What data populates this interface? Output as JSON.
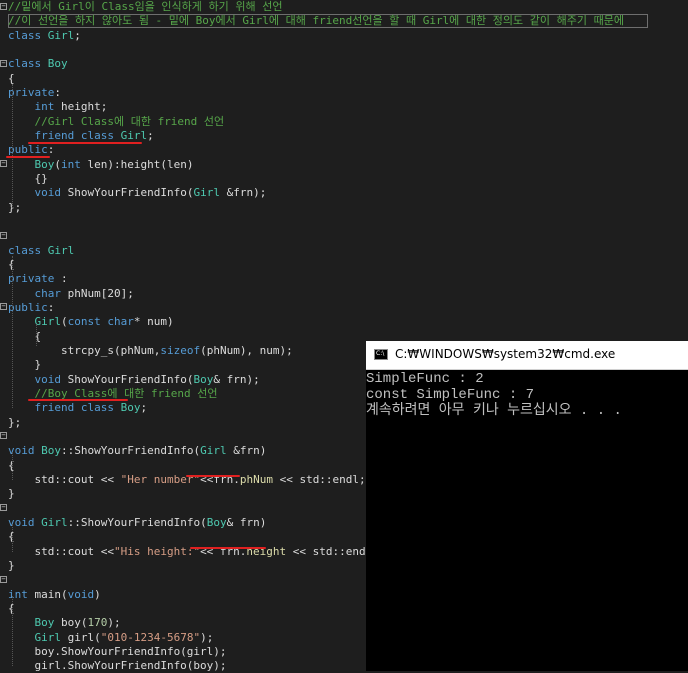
{
  "editor": {
    "lines": [
      {
        "segments": [
          {
            "t": "//밑에서 Girl이 Class임을 인식하게 하기 위해 선언",
            "c": "cm"
          }
        ]
      },
      {
        "segments": [
          {
            "t": "//이 선언을 하지 않아도 됨 - 밑에 Boy에서 Girl에 대해 friend선언을 할 때 Girl에 대한 정의도 같이 해주기 때문에",
            "c": "cm"
          }
        ]
      },
      {
        "segments": [
          {
            "t": "class ",
            "c": "kw"
          },
          {
            "t": "Girl",
            "c": "cls"
          },
          {
            "t": ";",
            "c": "tx"
          }
        ]
      },
      {
        "segments": []
      },
      {
        "segments": [
          {
            "t": "class ",
            "c": "kw"
          },
          {
            "t": "Boy",
            "c": "cls"
          }
        ]
      },
      {
        "segments": [
          {
            "t": "{",
            "c": "tx"
          }
        ]
      },
      {
        "segments": [
          {
            "t": "private",
            "c": "kw"
          },
          {
            "t": ":",
            "c": "tx"
          }
        ]
      },
      {
        "segments": [
          {
            "t": "    ",
            "c": "tx"
          },
          {
            "t": "int ",
            "c": "kw"
          },
          {
            "t": "height;",
            "c": "tx"
          }
        ]
      },
      {
        "segments": [
          {
            "t": "    //Girl Class에 대한 friend 선언",
            "c": "cm"
          }
        ]
      },
      {
        "segments": [
          {
            "t": "    ",
            "c": "tx"
          },
          {
            "t": "friend class ",
            "c": "kw"
          },
          {
            "t": "Girl",
            "c": "cls"
          },
          {
            "t": ";",
            "c": "tx"
          }
        ]
      },
      {
        "segments": [
          {
            "t": "public",
            "c": "kw"
          },
          {
            "t": ":",
            "c": "tx"
          }
        ]
      },
      {
        "segments": [
          {
            "t": "    ",
            "c": "tx"
          },
          {
            "t": "Boy",
            "c": "cls"
          },
          {
            "t": "(",
            "c": "tx"
          },
          {
            "t": "int ",
            "c": "kw"
          },
          {
            "t": "len):height(len)",
            "c": "tx"
          }
        ]
      },
      {
        "segments": [
          {
            "t": "    {}",
            "c": "tx"
          }
        ]
      },
      {
        "segments": [
          {
            "t": "    ",
            "c": "tx"
          },
          {
            "t": "void ",
            "c": "kw"
          },
          {
            "t": "ShowYourFriendInfo(",
            "c": "tx"
          },
          {
            "t": "Girl",
            "c": "cls"
          },
          {
            "t": " &frn);",
            "c": "tx"
          }
        ]
      },
      {
        "segments": [
          {
            "t": "};",
            "c": "tx"
          }
        ]
      },
      {
        "segments": []
      },
      {
        "segments": []
      },
      {
        "segments": [
          {
            "t": "class ",
            "c": "kw"
          },
          {
            "t": "Girl",
            "c": "cls"
          }
        ]
      },
      {
        "segments": [
          {
            "t": "{",
            "c": "tx"
          }
        ]
      },
      {
        "segments": [
          {
            "t": "private ",
            "c": "kw"
          },
          {
            "t": ":",
            "c": "tx"
          }
        ]
      },
      {
        "segments": [
          {
            "t": "    ",
            "c": "tx"
          },
          {
            "t": "char ",
            "c": "kw"
          },
          {
            "t": "phNum[20];",
            "c": "tx"
          }
        ]
      },
      {
        "segments": [
          {
            "t": "public",
            "c": "kw"
          },
          {
            "t": ":",
            "c": "tx"
          }
        ]
      },
      {
        "segments": [
          {
            "t": "    ",
            "c": "tx"
          },
          {
            "t": "Girl",
            "c": "cls"
          },
          {
            "t": "(",
            "c": "tx"
          },
          {
            "t": "const char",
            "c": "kw"
          },
          {
            "t": "* num)",
            "c": "tx"
          }
        ]
      },
      {
        "segments": [
          {
            "t": "    {",
            "c": "tx"
          }
        ]
      },
      {
        "segments": [
          {
            "t": "        strcpy_s(phNum,",
            "c": "tx"
          },
          {
            "t": "sizeof",
            "c": "kw"
          },
          {
            "t": "(phNum), num);",
            "c": "tx"
          }
        ]
      },
      {
        "segments": [
          {
            "t": "    }",
            "c": "tx"
          }
        ]
      },
      {
        "segments": [
          {
            "t": "    ",
            "c": "tx"
          },
          {
            "t": "void ",
            "c": "kw"
          },
          {
            "t": "ShowYourFriendInfo(",
            "c": "tx"
          },
          {
            "t": "Boy",
            "c": "cls"
          },
          {
            "t": "& frn);",
            "c": "tx"
          }
        ]
      },
      {
        "segments": [
          {
            "t": "    //Boy Class에 대한 friend 선언",
            "c": "cm"
          }
        ]
      },
      {
        "segments": [
          {
            "t": "    ",
            "c": "tx"
          },
          {
            "t": "friend class ",
            "c": "kw"
          },
          {
            "t": "Boy",
            "c": "cls"
          },
          {
            "t": ";",
            "c": "tx"
          }
        ]
      },
      {
        "segments": [
          {
            "t": "};",
            "c": "tx"
          }
        ]
      },
      {
        "segments": []
      },
      {
        "segments": [
          {
            "t": "void ",
            "c": "kw"
          },
          {
            "t": "Boy",
            "c": "cls"
          },
          {
            "t": "::ShowYourFriendInfo(",
            "c": "tx"
          },
          {
            "t": "Girl",
            "c": "cls"
          },
          {
            "t": " &frn)",
            "c": "tx"
          }
        ]
      },
      {
        "segments": [
          {
            "t": "{",
            "c": "tx"
          }
        ]
      },
      {
        "segments": [
          {
            "t": "    std::cout << ",
            "c": "tx"
          },
          {
            "t": "\"Her number\"",
            "c": "str"
          },
          {
            "t": "<<frn.",
            "c": "tx"
          },
          {
            "t": "phNum",
            "c": "fn"
          },
          {
            "t": " << std::endl;",
            "c": "tx"
          }
        ]
      },
      {
        "segments": [
          {
            "t": "}",
            "c": "tx"
          }
        ]
      },
      {
        "segments": []
      },
      {
        "segments": [
          {
            "t": "void ",
            "c": "kw"
          },
          {
            "t": "Girl",
            "c": "cls"
          },
          {
            "t": "::ShowYourFriendInfo(",
            "c": "tx"
          },
          {
            "t": "Boy",
            "c": "cls"
          },
          {
            "t": "& frn)",
            "c": "tx"
          }
        ]
      },
      {
        "segments": [
          {
            "t": "{",
            "c": "tx"
          }
        ]
      },
      {
        "segments": [
          {
            "t": "    std::cout <<",
            "c": "tx"
          },
          {
            "t": "\"His height:\"",
            "c": "str"
          },
          {
            "t": "<< frn.",
            "c": "tx"
          },
          {
            "t": "height",
            "c": "fn"
          },
          {
            "t": " << std::endl;",
            "c": "tx"
          }
        ]
      },
      {
        "segments": [
          {
            "t": "}",
            "c": "tx"
          }
        ]
      },
      {
        "segments": []
      },
      {
        "segments": [
          {
            "t": "int ",
            "c": "kw"
          },
          {
            "t": "main(",
            "c": "tx"
          },
          {
            "t": "void",
            "c": "kw"
          },
          {
            "t": ")",
            "c": "tx"
          }
        ]
      },
      {
        "segments": [
          {
            "t": "{",
            "c": "tx"
          }
        ]
      },
      {
        "segments": [
          {
            "t": "    ",
            "c": "tx"
          },
          {
            "t": "Boy",
            "c": "cls"
          },
          {
            "t": " boy(",
            "c": "tx"
          },
          {
            "t": "170",
            "c": "num"
          },
          {
            "t": ");",
            "c": "tx"
          }
        ]
      },
      {
        "segments": [
          {
            "t": "    ",
            "c": "tx"
          },
          {
            "t": "Girl",
            "c": "cls"
          },
          {
            "t": " girl(",
            "c": "tx"
          },
          {
            "t": "\"010-1234-5678\"",
            "c": "str"
          },
          {
            "t": ");",
            "c": "tx"
          }
        ]
      },
      {
        "segments": [
          {
            "t": "    boy.ShowYourFriendInfo(girl);",
            "c": "tx"
          }
        ]
      },
      {
        "segments": [
          {
            "t": "    girl.ShowYourFriendInfo(boy);",
            "c": "tx"
          }
        ]
      }
    ],
    "fold_markers": [
      "−",
      "−",
      "−",
      "−",
      "−",
      "−",
      "−",
      "−"
    ]
  },
  "console": {
    "title": "C:₩WINDOWS₩system32₩cmd.exe",
    "icon_text": "C:\\",
    "output": [
      "SimpleFunc : 2",
      "const SimpleFunc : 7",
      "계속하려면 아무 키나 누르십시오 . . ."
    ]
  },
  "colors": {
    "background": "#1e1e1e",
    "keyword": "#569cd6",
    "class": "#4ec9b0",
    "comment": "#57a64a",
    "string": "#d69d85",
    "text": "#dcdcdc",
    "annotation_underline": "#e02020",
    "console_bg": "#000000",
    "console_text": "#c0c0c0"
  }
}
